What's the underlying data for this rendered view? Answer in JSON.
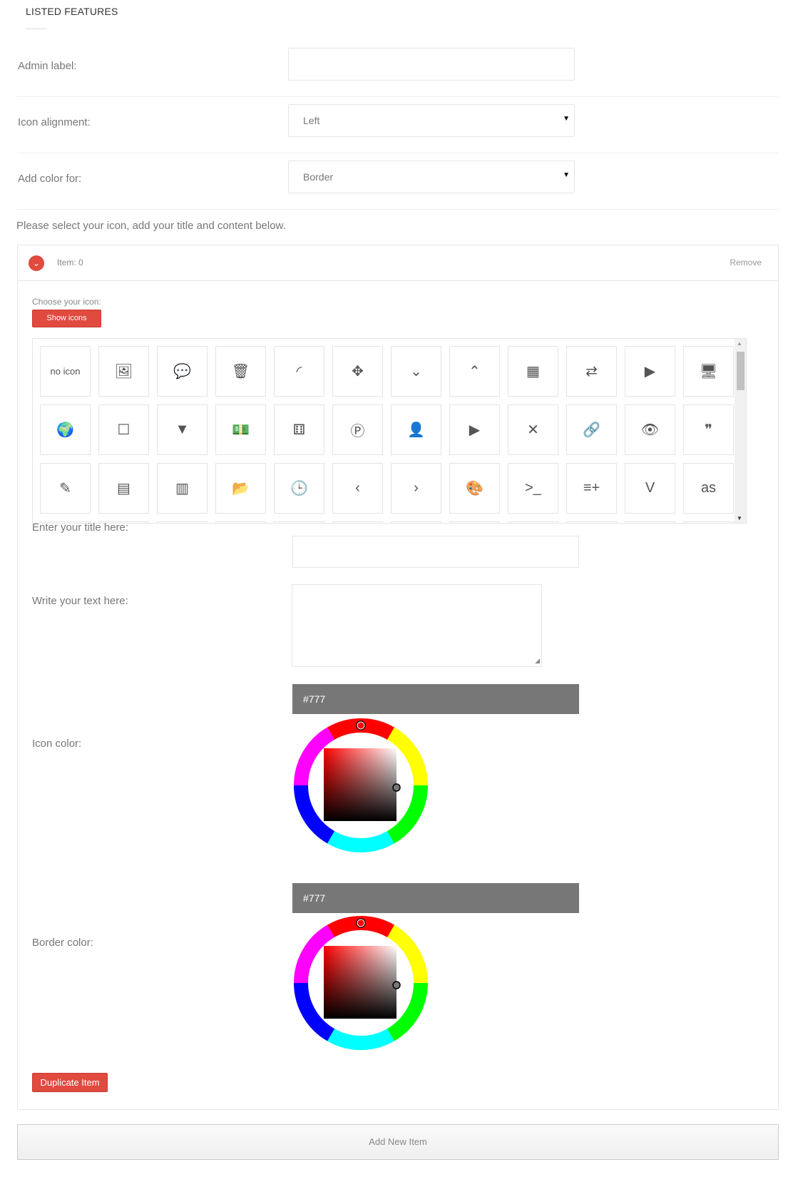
{
  "section": {
    "title": "LISTED FEATURES"
  },
  "fields": {
    "admin_label": {
      "label": "Admin label:",
      "value": ""
    },
    "icon_alignment": {
      "label": "Icon alignment:",
      "value": "Left"
    },
    "add_color_for": {
      "label": "Add color for:",
      "value": "Border"
    }
  },
  "instructions": "Please select your icon, add your title and content below.",
  "item": {
    "label": "Item: 0",
    "remove_label": "Remove",
    "choose_icon_label": "Choose your icon:",
    "show_icons_label": "Show icons",
    "icons": [
      {
        "name": "no-icon",
        "glyph": "no icon"
      },
      {
        "name": "image-icon",
        "glyph": "🖼"
      },
      {
        "name": "comments-icon",
        "glyph": "💬"
      },
      {
        "name": "trash-icon",
        "glyph": "🗑"
      },
      {
        "name": "rss-icon",
        "glyph": "◜"
      },
      {
        "name": "move-icon",
        "glyph": "✥"
      },
      {
        "name": "chevron-down-icon",
        "glyph": "⌄"
      },
      {
        "name": "chevron-up-icon",
        "glyph": "⌃"
      },
      {
        "name": "dashboard-icon",
        "glyph": "▦"
      },
      {
        "name": "exchange-icon",
        "glyph": "⇄"
      },
      {
        "name": "play-circle-icon",
        "glyph": "▶"
      },
      {
        "name": "desktop-icon",
        "glyph": "🖥"
      },
      {
        "name": "globe-icon",
        "glyph": "🌍"
      },
      {
        "name": "square-icon",
        "glyph": "☐"
      },
      {
        "name": "filter-icon",
        "glyph": "▼"
      },
      {
        "name": "money-icon",
        "glyph": "💵"
      },
      {
        "name": "flickr-icon",
        "glyph": "⚅"
      },
      {
        "name": "pinterest-icon",
        "glyph": "Ⓟ"
      },
      {
        "name": "user-icon",
        "glyph": "👤"
      },
      {
        "name": "youtube-play-icon",
        "glyph": "▶"
      },
      {
        "name": "times-icon",
        "glyph": "✕"
      },
      {
        "name": "link-icon",
        "glyph": "🔗"
      },
      {
        "name": "eye-icon",
        "glyph": "👁"
      },
      {
        "name": "quote-right-icon",
        "glyph": "❞"
      },
      {
        "name": "pencil-icon",
        "glyph": "✎"
      },
      {
        "name": "file-text-icon",
        "glyph": "▤"
      },
      {
        "name": "newspaper-icon",
        "glyph": "▥"
      },
      {
        "name": "folder-open-icon",
        "glyph": "📂"
      },
      {
        "name": "clock-icon",
        "glyph": "🕒"
      },
      {
        "name": "angle-left-icon",
        "glyph": "‹"
      },
      {
        "name": "angle-right-icon",
        "glyph": "›"
      },
      {
        "name": "paint-brush-icon",
        "glyph": "🎨"
      },
      {
        "name": "terminal-icon",
        "glyph": ">_"
      },
      {
        "name": "list-add-icon",
        "glyph": "≡+"
      },
      {
        "name": "vimeo-icon",
        "glyph": "V"
      },
      {
        "name": "lastfm-icon",
        "glyph": "as"
      }
    ],
    "title_label": "Enter your title here:",
    "title_value": "",
    "text_label": "Write your text here:",
    "text_value": "",
    "icon_color": {
      "label": "Icon color:",
      "value": "#777"
    },
    "border_color": {
      "label": "Border color:",
      "value": "#777"
    },
    "duplicate_label": "Duplicate Item"
  },
  "add_new_label": "Add New Item",
  "colors": {
    "accent": "#e04a3f",
    "swatch": "#777777"
  }
}
